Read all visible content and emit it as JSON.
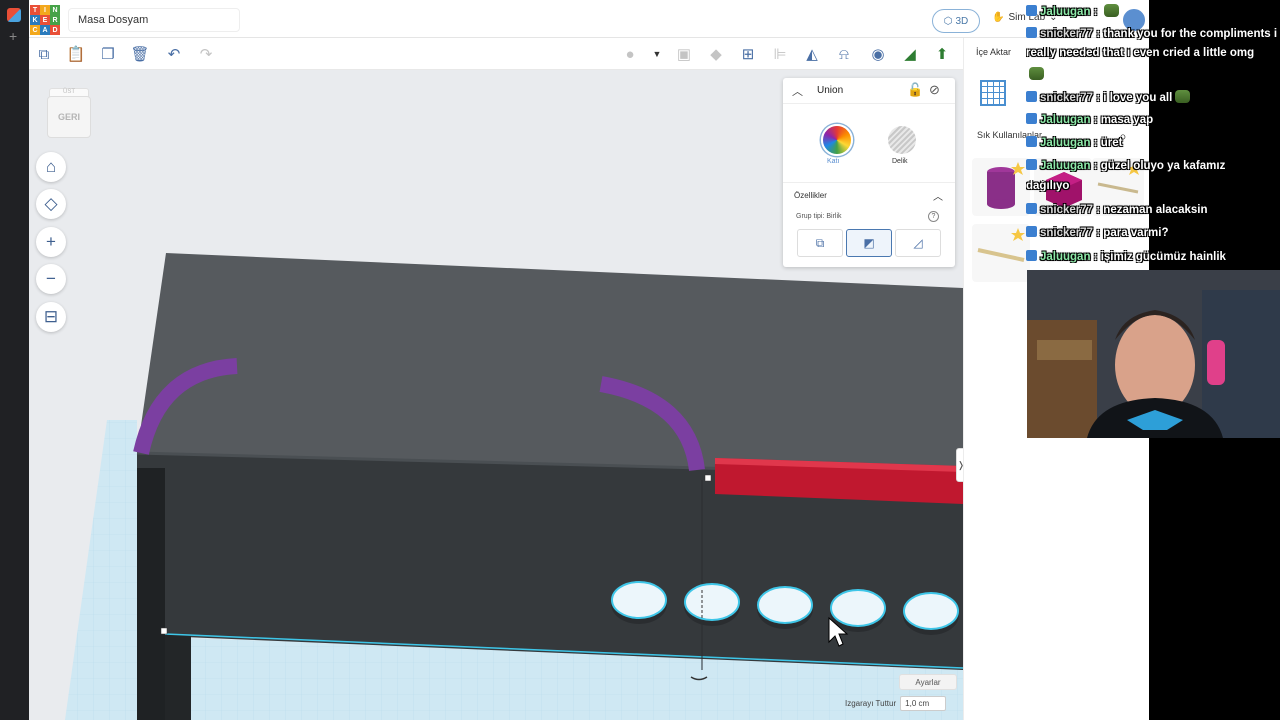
{
  "app": {
    "document_title": "Masa Dosyam",
    "logo_letters": [
      "T",
      "I",
      "N",
      "K",
      "E",
      "R",
      "C",
      "A",
      "D"
    ],
    "logo_colors": [
      "#e94f37",
      "#f3a81c",
      "#46a248",
      "#2a7bbd",
      "#e94f37",
      "#46a248",
      "#f3a81c",
      "#2a7bbd",
      "#e94f37"
    ],
    "view_mode": "3D",
    "sim_lab": "Sim Lab",
    "import_label": "İçe Aktar"
  },
  "toolbar": {
    "icons": [
      "copy-icon",
      "paste-icon",
      "duplicate-icon",
      "delete-icon",
      "undo-icon",
      "redo-icon"
    ],
    "right_icons": [
      "light-bulb-icon",
      "dropdown-caret-icon",
      "hide-icon",
      "show-all-icon",
      "group-icon",
      "align-icon",
      "mirror-icon",
      "cruise-icon",
      "view-icon",
      "export-icon",
      "import-shape-icon"
    ]
  },
  "viewcube": {
    "face": "GERI",
    "top_face": "ÜST"
  },
  "nav_buttons": [
    "home-icon",
    "fit-icon",
    "zoom-in-icon",
    "zoom-out-icon",
    "ortho-icon"
  ],
  "inspector": {
    "title": "Union",
    "solid_label": "Katı",
    "hole_label": "Delik",
    "properties_title": "Özellikler",
    "group_type": "Grup tipi: Birlik"
  },
  "right_panel": {
    "dropdown_label": "Sık Kullanılanlar"
  },
  "viewport_footer": {
    "settings_label": "Ayarlar",
    "snap_label": "Izgarayı Tuttur",
    "snap_value": "1,0 cm"
  },
  "colors": {
    "accent": "#4a78b0",
    "purple_part": "#7b3fa1",
    "red_part": "#c0182f",
    "workplane": "#cfe8f3"
  },
  "chat": [
    {
      "user": "Jaluugan",
      "text": " : ",
      "has_emote": true,
      "user_class": "user"
    },
    {
      "user": "snicker77",
      "text": " : thank you for the compliments i",
      "has_emote": false,
      "user_class": "user snk"
    },
    {
      "user": "",
      "text": "really needed that i even cried a little omg",
      "has_emote": false,
      "user_class": "user"
    },
    {
      "user": "",
      "text": "",
      "has_emote": true,
      "user_class": "user"
    },
    {
      "user": "snicker77",
      "text": " : i love you all",
      "has_emote": true,
      "user_class": "user snk"
    },
    {
      "user": "Jaluugan",
      "text": " : masa yap",
      "has_emote": false,
      "user_class": "user"
    },
    {
      "user": "Jaluugan",
      "text": " : üret",
      "has_emote": false,
      "user_class": "user"
    },
    {
      "user": "Jaluugan",
      "text": " : güzel oluyo ya kafamız",
      "has_emote": false,
      "user_class": "user"
    },
    {
      "user": "",
      "text": "dağılıyo",
      "has_emote": false,
      "user_class": "user"
    },
    {
      "user": "snicker77",
      "text": " : nezaman alacaksin",
      "has_emote": false,
      "user_class": "user snk"
    },
    {
      "user": "snicker77",
      "text": " : para varmi?",
      "has_emote": false,
      "user_class": "user snk"
    },
    {
      "user": "Jaluugan",
      "text": " : işimiz gücümüz hainlik",
      "has_emote": false,
      "user_class": "user"
    }
  ]
}
